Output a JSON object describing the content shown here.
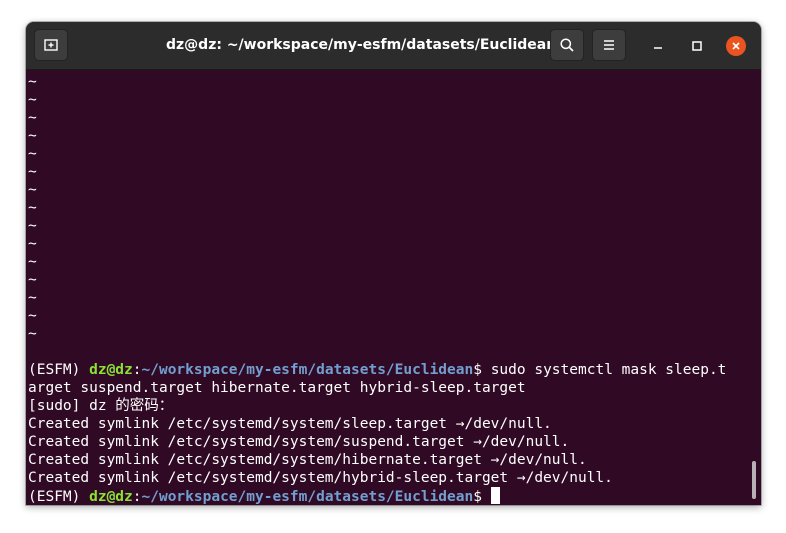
{
  "window": {
    "title": "dz@dz: ~/workspace/my-esfm/datasets/Euclidean"
  },
  "icons": {
    "new_tab": "new-tab-icon",
    "search": "search-icon",
    "menu": "hamburger-menu-icon",
    "minimize": "minimize-icon",
    "maximize": "maximize-icon",
    "close": "close-icon"
  },
  "colors": {
    "terminal_bg": "#300a24",
    "titlebar_bg": "#2c2c2c",
    "prompt_user": "#8ae234",
    "prompt_path": "#729fcf",
    "close_button": "#e95420"
  },
  "terminal": {
    "tilde_lines": [
      "~",
      "~",
      "~",
      "~",
      "~",
      "~",
      "~",
      "~",
      "~",
      "~",
      "~",
      "~",
      "~",
      "~",
      "~"
    ],
    "prompt1": {
      "env": "(ESFM) ",
      "user": "dz@dz",
      "colon": ":",
      "path": "~/workspace/my-esfm/datasets/Euclidean",
      "symbol": "$ ",
      "command": "sudo systemctl mask sleep.t"
    },
    "wrap_line": "arget suspend.target hibernate.target hybrid-sleep.target",
    "sudo_prompt": "[sudo] dz 的密码：",
    "outputs": [
      "Created symlink /etc/systemd/system/sleep.target →/dev/null.",
      "Created symlink /etc/systemd/system/suspend.target →/dev/null.",
      "Created symlink /etc/systemd/system/hibernate.target →/dev/null.",
      "Created symlink /etc/systemd/system/hybrid-sleep.target →/dev/null."
    ],
    "prompt2": {
      "env": "(ESFM) ",
      "user": "dz@dz",
      "colon": ":",
      "path": "~/workspace/my-esfm/datasets/Euclidean",
      "symbol": "$ "
    }
  }
}
